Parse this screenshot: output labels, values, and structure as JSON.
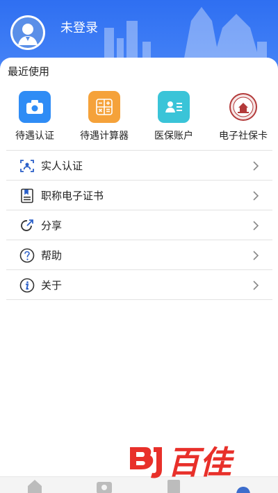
{
  "header": {
    "login_status": "未登录",
    "avatar_icon": "user-avatar-icon",
    "bg_color": "#3574f3"
  },
  "recent": {
    "title": "最近使用",
    "items": [
      {
        "label": "待遇认证",
        "icon": "camera-icon",
        "color": "#2f8cf5"
      },
      {
        "label": "待遇计算器",
        "icon": "calculator-icon",
        "color": "#f5a23a"
      },
      {
        "label": "医保账户",
        "icon": "id-card-icon",
        "color": "#3ac4d8"
      },
      {
        "label": "电子社保卡",
        "icon": "social-security-emblem-icon",
        "color": "#b33a3a"
      }
    ]
  },
  "menu": {
    "items": [
      {
        "label": "实人认证",
        "icon": "face-scan-icon"
      },
      {
        "label": "职称电子证书",
        "icon": "certificate-icon"
      },
      {
        "label": "分享",
        "icon": "share-icon"
      },
      {
        "label": "帮助",
        "icon": "help-icon"
      },
      {
        "label": "关于",
        "icon": "info-icon"
      }
    ]
  },
  "watermark": {
    "text": "百佳",
    "logo_color": "#e8302a"
  },
  "bottom_nav": {
    "icons": [
      "home-icon",
      "camera-icon",
      "document-icon",
      "profile-icon"
    ]
  }
}
